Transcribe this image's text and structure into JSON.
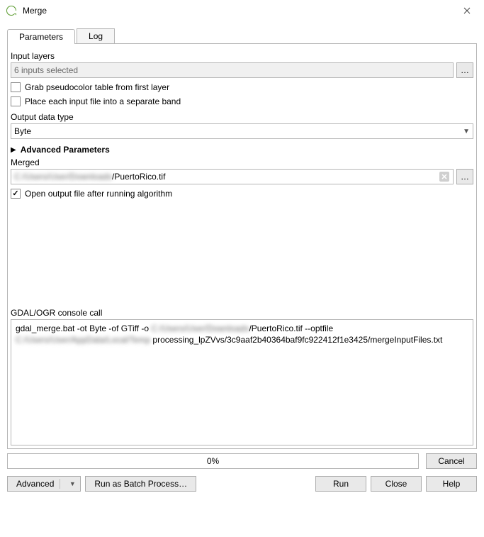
{
  "window": {
    "title": "Merge"
  },
  "tabs": {
    "parameters": "Parameters",
    "log": "Log"
  },
  "form": {
    "input_layers_label": "Input layers",
    "input_layers_value": "6 inputs selected",
    "ellipsis": "…",
    "grab_pseudocolor_label": "Grab pseudocolor table from first layer",
    "grab_pseudocolor_checked": false,
    "place_each_band_label": "Place each input file into a separate band",
    "place_each_band_checked": false,
    "output_type_label": "Output data type",
    "output_type_value": "Byte",
    "advanced_parameters_label": "Advanced Parameters",
    "merged_label": "Merged",
    "merged_value": "/PuertoRico.tif",
    "merged_blur_prefix": "C:/Users/User/Downloads",
    "open_after_label": "Open output file after running algorithm",
    "open_after_checked": true,
    "console_label": "GDAL/OGR console call",
    "console_text_pre": "gdal_merge.bat -ot Byte -of GTiff -o ",
    "console_blur1": "C:/Users/User/Downloads",
    "console_text_mid": "/PuertoRico.tif --optfile ",
    "console_blur2": "C:/Users/User/AppData/Local/Temp",
    "console_text_post": "processing_lpZVvs/3c9aaf2b40364baf9fc922412f1e3425/mergeInputFiles.txt"
  },
  "progress": {
    "percent_text": "0%"
  },
  "buttons": {
    "cancel": "Cancel",
    "advanced": "Advanced",
    "run_batch": "Run as Batch Process…",
    "run": "Run",
    "close": "Close",
    "help": "Help"
  }
}
